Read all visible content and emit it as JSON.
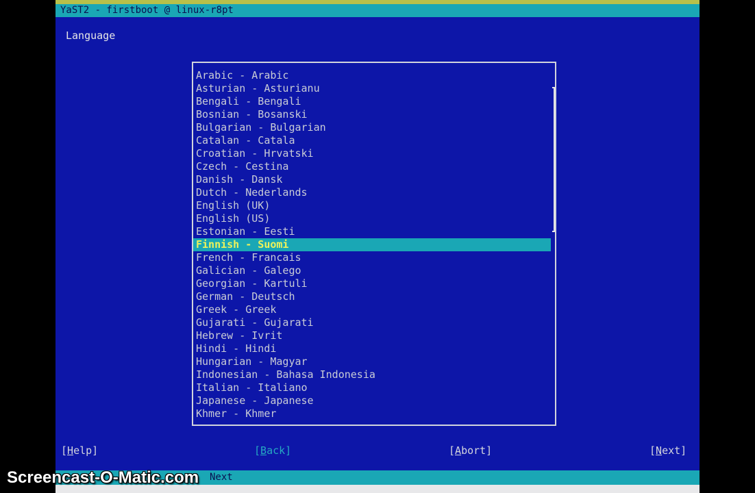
{
  "window": {
    "title": "YaST2 - firstboot @ linux-r8pt"
  },
  "page": {
    "heading": "Language"
  },
  "language_list": {
    "selected_index": 13,
    "items": [
      "Arabic - Arabic",
      "Asturian - Asturianu",
      "Bengali - Bengali",
      "Bosnian - Bosanski",
      "Bulgarian - Bulgarian",
      "Catalan - Catala",
      "Croatian - Hrvatski",
      "Czech - Cestina",
      "Danish - Dansk",
      "Dutch - Nederlands",
      "English (UK)",
      "English (US)",
      "Estonian - Eesti",
      "Finnish - Suomi",
      "French - Francais",
      "Galician - Galego",
      "Georgian - Kartuli",
      "German - Deutsch",
      "Greek - Greek",
      "Gujarati - Gujarati",
      "Hebrew - Ivrit",
      "Hindi - Hindi",
      "Hungarian - Magyar",
      "Indonesian - Bahasa Indonesia",
      "Italian - Italiano",
      "Japanese - Japanese",
      "Khmer - Khmer"
    ]
  },
  "footer": {
    "help": {
      "open": "[",
      "hot": "H",
      "rest": "elp]"
    },
    "back": {
      "open": "[",
      "hot": "B",
      "rest": "ack]"
    },
    "abort": {
      "open": "[",
      "hot": "A",
      "rest": "bort]"
    },
    "next": {
      "open": "[",
      "hot": "N",
      "rest": "ext]"
    }
  },
  "status_bar": {
    "key_hint": "Next"
  },
  "watermark": {
    "text": "Screencast-O-Matic.com"
  },
  "colors": {
    "background": "#0d16a8",
    "title_bar": "#1aa7b5",
    "selection_text": "#eef25a"
  }
}
